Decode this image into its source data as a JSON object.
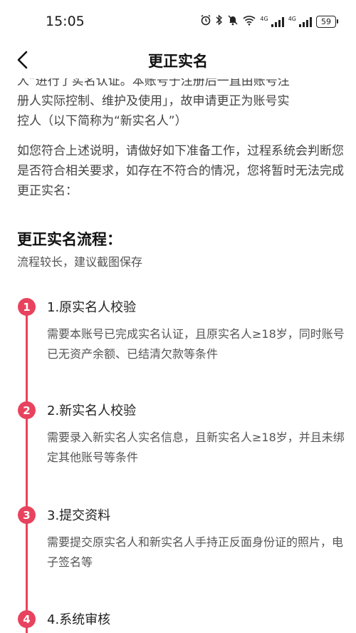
{
  "status_bar": {
    "time": "15:05",
    "network_4g_1": "4G",
    "network_4g_2": "4G",
    "battery": "59"
  },
  "nav": {
    "title": "更正实名"
  },
  "intro": {
    "line_partial": "人”进行了实名认证。本账号于注册后一直由账号注",
    "line_2": "册人实际控制、维护及使用」，故申请更正为账号实",
    "line_3": "控人（以下简称为“新实名人”）",
    "paragraph_2": "如您符合上述说明，请做好如下准备工作，过程系统会判断您是否符合相关要求，如存在不符合的情况，您将暂时无法完成更正实名："
  },
  "section": {
    "title": "更正实名流程：",
    "subtitle": "流程较长，建议截图保存"
  },
  "steps": [
    {
      "num": "1",
      "title": "1.原实名人校验",
      "desc": "需要本账号已完成实名认证，且原实名人≥18岁，同时账号已无资产余额、已结清欠款等条件"
    },
    {
      "num": "2",
      "title": "2.新实名人校验",
      "desc": "需要录入新实名人实名信息，且新实名人≥18岁，并且未绑定其他账号等条件"
    },
    {
      "num": "3",
      "title": "3.提交资料",
      "desc": "需要提交原实名人和新实名人手持正反面身份证的照片，电子签名等"
    },
    {
      "num": "4",
      "title": "4.系统审核",
      "desc": ""
    }
  ],
  "colors": {
    "accent": "#e8435e",
    "text_primary": "#111111",
    "text_secondary": "#555555"
  }
}
